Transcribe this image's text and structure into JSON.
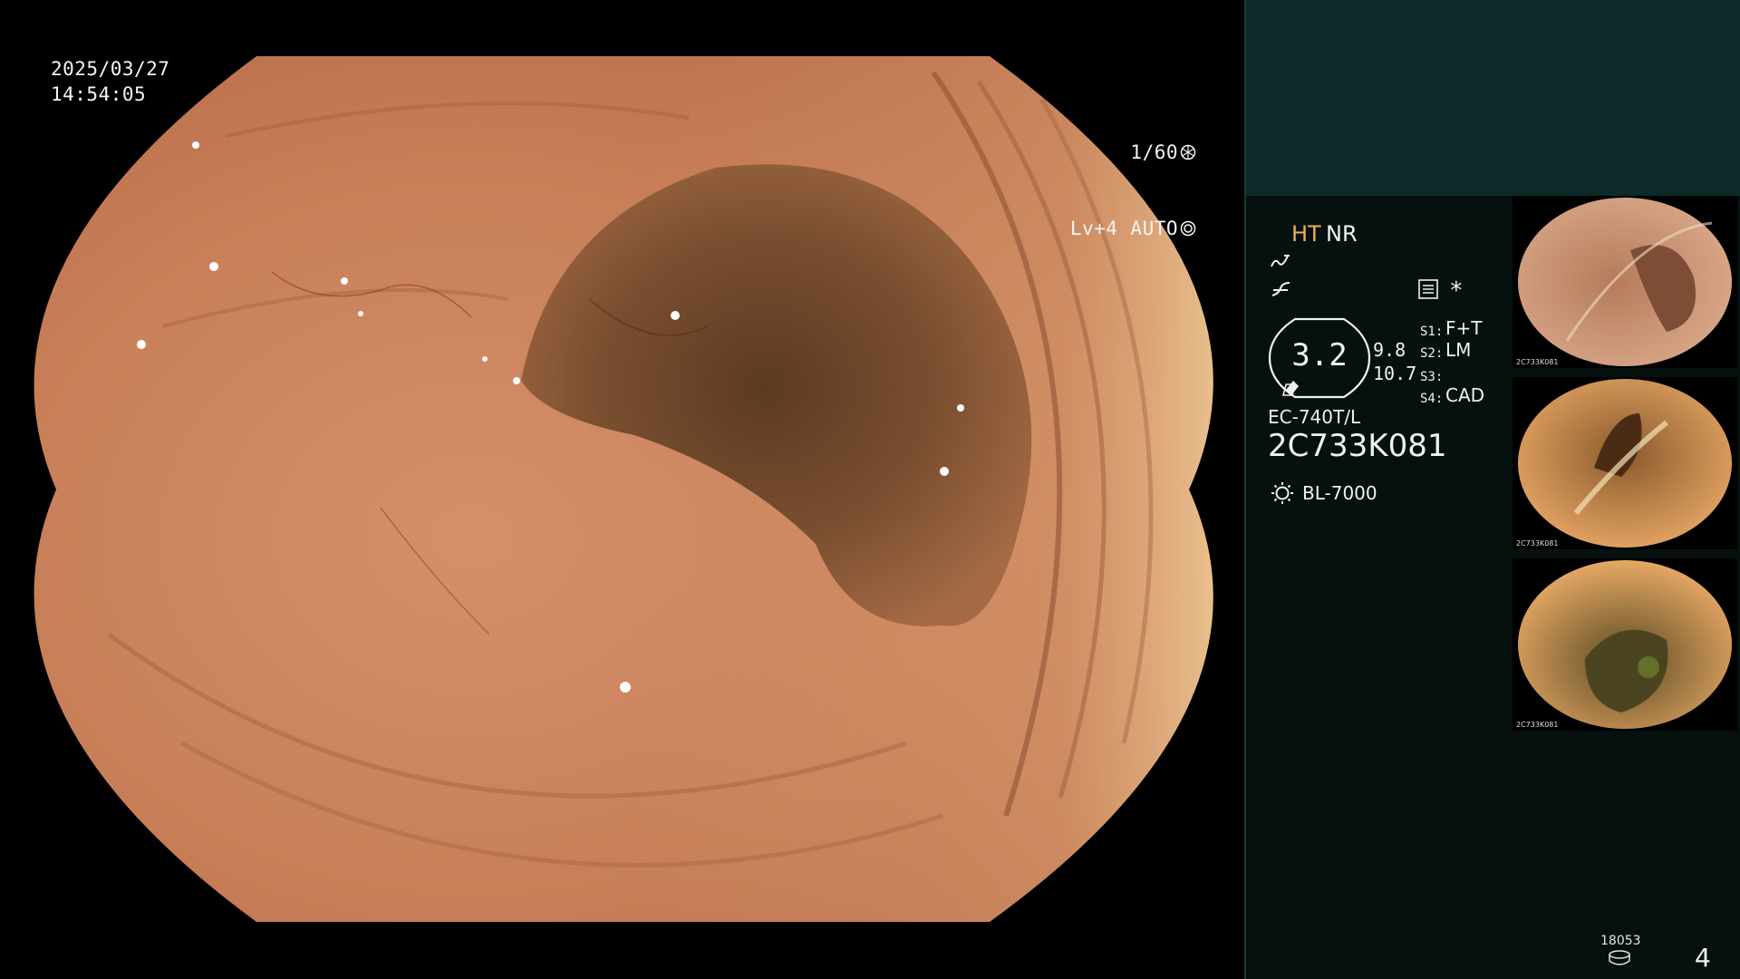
{
  "overlay": {
    "date": "2025/03/27",
    "time": "14:54:05",
    "shutter": "1/60",
    "level": "Lv+4",
    "iris": "AUTO"
  },
  "panel": {
    "mode_ht": "HT",
    "mode_nr": "NR",
    "asterisk": "*",
    "zoom_value": "3.2",
    "sub_value_1": "9.8",
    "sub_value_2": "10.7",
    "settings": [
      {
        "label": "S1:",
        "value": "F+T"
      },
      {
        "label": "S2:",
        "value": "LM"
      },
      {
        "label": "S3:",
        "value": ""
      },
      {
        "label": "S4:",
        "value": "CAD"
      }
    ],
    "scope_model": "EC-740T/L",
    "scope_serial": "2C733K081",
    "light_source": "BL-7000",
    "image_counter": "18053",
    "page_number": "4",
    "thumb_label": "2C733K081"
  },
  "icons": {
    "shutter": "aperture-icon",
    "iris": "iris-icon",
    "enhance": "enhance-icon",
    "curve": "tone-curve-icon",
    "menu": "menu-icon",
    "light": "light-bulb-icon",
    "disk": "disk-icon"
  },
  "colors": {
    "panel_bg": "#06100f",
    "panel_top": "#0c2a28",
    "ht_accent": "#f0b24a"
  }
}
